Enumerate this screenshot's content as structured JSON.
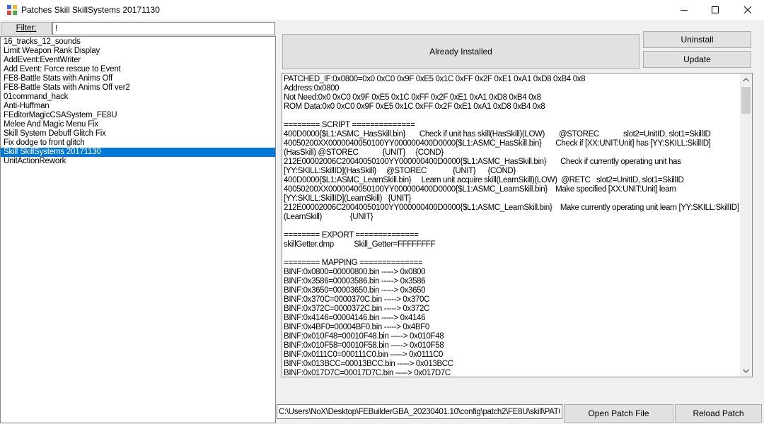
{
  "window": {
    "title": "Patches Skill SkillSystems 20171130"
  },
  "filter": {
    "label": "Filter:",
    "value": "!"
  },
  "patch_list": {
    "items": [
      "16_tracks_12_sounds",
      "Limit Weapon Rank Display",
      "AddEvent:EventWriter",
      "Add Event: Force rescue to Event",
      "FE8-Battle Stats with Anims Off",
      "FE8-Battle Stats with Anims Off ver2",
      "01command_hack",
      "Anti-Huffman",
      "FEditorMagicCSASystem_FE8U",
      "Melee And Magic Menu Fix",
      "Skill System Debuff Glitch Fix",
      "Fix dodge to front glitch",
      "Skill SkillSystems 20171130",
      "UnitActionRework"
    ],
    "selected_index": 12
  },
  "status": {
    "text": "Already Installed"
  },
  "buttons": {
    "uninstall": "Uninstall",
    "update": "Update",
    "open_patch_file": "Open Patch File",
    "reload_patch": "Reload Patch"
  },
  "info_text": "PATCHED_IF:0x0800=0x0 0xC0 0x9F 0xE5 0x1C 0xFF 0x2F 0xE1 0xA1 0xD8 0xB4 0x8\nAddress:0x0800\nNot Need:0x0 0xC0 0x9F 0xE5 0x1C 0xFF 0x2F 0xE1 0xA1 0xD8 0xB4 0x8\nROM Data:0x0 0xC0 0x9F 0xE5 0x1C 0xFF 0x2F 0xE1 0xA1 0xD8 0xB4 0x8\n\n======== SCRIPT ==============\n400D0000{$L1:ASMC_HasSkill.bin}       Check if unit has skill(HasSkill)(LOW)       @STOREC            slot2=UnitID, slot1=SkillID\n40050200XX0000040050100YY000000400D0000{$L1:ASMC_HasSkill.bin}       Check if [XX:UNIT:Unit] has [YY:SKILL:SkillID]\n(HasSkill) @STOREC            {UNIT}     {COND}\n212E00002006C20040050100YY000000400D0000{$L1:ASMC_HasSkill.bin}       Check if currently operating unit has\n[YY:SKILL:SkillID](HasSkill)     @STOREC             {UNIT}      {COND}\n400D0000{$L1:ASMC_LearnSkill.bin}     Learn unit acquire skill(LearnSkill)(LOW)  @RETC   slot2=UnitID, slot1=SkillID\n40050200XX0000040050100YY000000400D0000{$L1:ASMC_LearnSkill.bin}    Make specified [XX:UNIT:Unit] learn\n[YY:SKILL:SkillID](LearnSkill)   {UNIT}\n212E00002006C20040050100YY000000400D0000{$L1:ASMC_LearnSkill.bin}    Make currently operating unit learn [YY:SKILL:SkillID]\n(LearnSkill)              {UNIT}\n\n======== EXPORT ==============\nskillGetter.dmp          Skill_Getter=FFFFFFFF\n\n======== MAPPING ==============\nBINF:0x0800=00000800.bin -----> 0x0800\nBINF:0x3586=00003586.bin -----> 0x3586\nBINF:0x3650=00003650.bin -----> 0x3650\nBINF:0x370C=0000370C.bin -----> 0x370C\nBINF:0x372C=0000372C.bin -----> 0x372C\nBINF:0x4146=00004146.bin -----> 0x4146\nBINF:0x4BF0=00004BF0.bin -----> 0x4BF0\nBINF:0x010F48=00010F48.bin -----> 0x010F48\nBINF:0x010F58=00010F58.bin -----> 0x010F58\nBINF:0x0111C0=000111C0.bin -----> 0x0111C0\nBINF:0x013BCC=00013BCC.bin -----> 0x013BCC\nBINF:0x017D7C=00017D7C.bin -----> 0x017D7C",
  "path_field": {
    "value": "C:\\Users\\NoX\\Desktop\\FEBuilderGBA_20230401.10\\config\\patch2\\FE8U\\skill\\PATCH_SkillSystems.txt"
  },
  "icons": {
    "app": "app-icon",
    "minimize": "minimize-icon",
    "maximize": "maximize-icon",
    "close": "close-icon",
    "scroll_up": "chevron-up-icon",
    "scroll_down": "chevron-down-icon"
  },
  "colors": {
    "selection": "#0078d7",
    "button_face": "#e1e1e1",
    "window_bg": "#f0f0f0"
  }
}
